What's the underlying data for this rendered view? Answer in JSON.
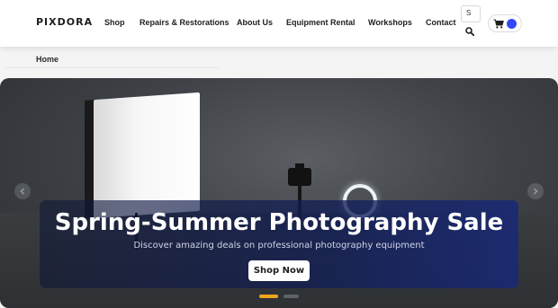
{
  "brand": {
    "name": "PIXDORA"
  },
  "nav": [
    {
      "label": "Shop"
    },
    {
      "label": "Repairs & Restorations"
    },
    {
      "label": "About Us"
    },
    {
      "label": "Equipment Rental"
    },
    {
      "label": "Workshops"
    },
    {
      "label": "Contact"
    }
  ],
  "search": {
    "value": "S",
    "icon": "search-icon"
  },
  "cart": {
    "icon": "cart-icon",
    "badge_color": "#3347ff"
  },
  "breadcrumb": {
    "current": "Home"
  },
  "hero": {
    "title": "Spring-Summer Photography Sale",
    "subtitle": "Discover amazing deals on professional photography equipment",
    "cta": "Shop Now",
    "slides_total": 2,
    "active_slide": 1,
    "active_dot_color": "#f0a41c",
    "inactive_dot_color": "#5f6266"
  },
  "colors": {
    "accent": "#3347ff",
    "caption_bg": "#1a2a6e"
  }
}
